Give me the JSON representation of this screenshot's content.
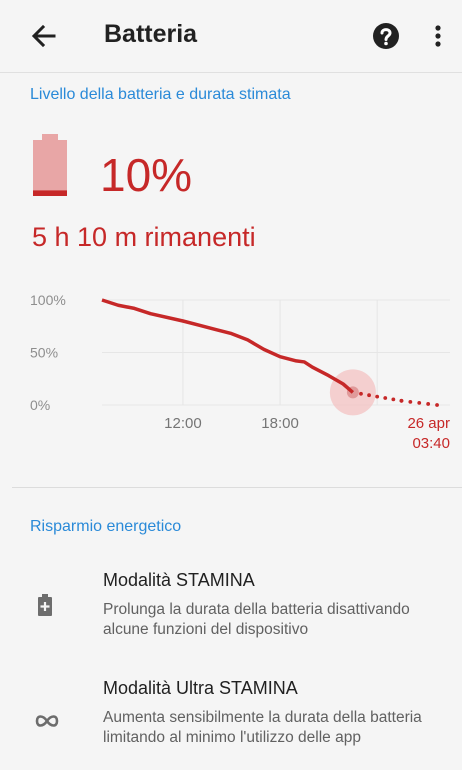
{
  "appbar": {
    "title": "Batteria",
    "back_icon": "arrow-left-icon",
    "help_icon": "help-circle-icon",
    "more_icon": "more-vert-icon"
  },
  "battery_section": {
    "header": "Livello della batteria e durata stimata",
    "level": "10%",
    "remaining": "5 h  10 m rimanenti",
    "level_fraction": 0.1
  },
  "chart_data": {
    "type": "line",
    "y_tick_labels": [
      "100%",
      "50%",
      "0%"
    ],
    "x_tick_labels": [
      "12:00",
      "18:00"
    ],
    "end_label_date": "26 apr",
    "end_label_time": "03:40",
    "ylim": [
      0,
      100
    ],
    "x_hours_range": [
      7,
      28.5
    ],
    "series": [
      {
        "points": [
          [
            7,
            100
          ],
          [
            8,
            95
          ],
          [
            9,
            92
          ],
          [
            10,
            87
          ],
          [
            12,
            80
          ],
          [
            13,
            76
          ],
          [
            14,
            72
          ],
          [
            15,
            68
          ],
          [
            16,
            62
          ],
          [
            17,
            53
          ],
          [
            18,
            46
          ],
          [
            19,
            42
          ],
          [
            19.5,
            41
          ],
          [
            20,
            36
          ],
          [
            21,
            28
          ],
          [
            21.9,
            20
          ],
          [
            22.5,
            12
          ]
        ]
      },
      {
        "projected": true,
        "points": [
          [
            22.5,
            12
          ],
          [
            25.5,
            4
          ],
          [
            27.7,
            0
          ]
        ]
      }
    ],
    "colors": {
      "line": "#c62828",
      "grid": "#e6e6e6",
      "marker": "#f3c2c2",
      "axis_label": "#8e8e8e"
    }
  },
  "power_saving": {
    "header": "Risparmio energetico",
    "items": [
      {
        "icon": "battery-plus-icon",
        "title": "Modalità STAMINA",
        "description": "Prolunga la durata della batteria disattivando alcune funzioni del dispositivo"
      },
      {
        "icon": "infinity-icon",
        "title": "Modalità Ultra STAMINA",
        "description": "Aumenta sensibilmente la durata della batteria limitando al minimo l'utilizzo delle app"
      }
    ]
  },
  "colors": {
    "accent": "#2a8ad8",
    "warning": "#c62828",
    "battery_fill": "#e8a6a6"
  }
}
